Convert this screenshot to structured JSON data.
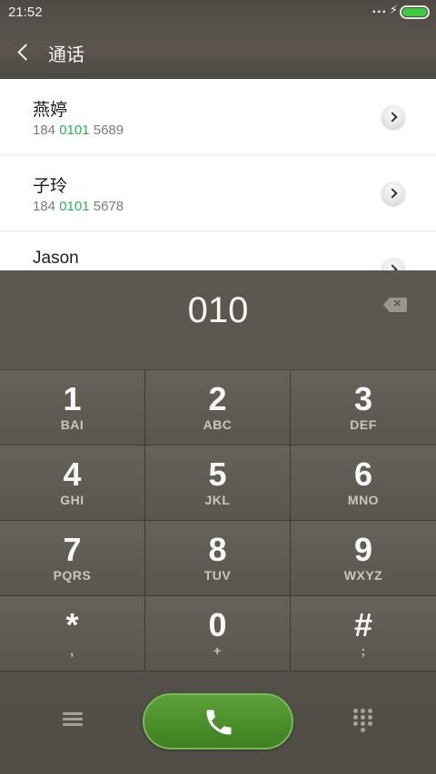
{
  "status_bar": {
    "time": "21:52",
    "dots": "...",
    "charging_icon": "bolt-icon",
    "battery_icon": "battery-icon",
    "battery_color": "#3fc93f"
  },
  "header": {
    "title": "通话",
    "back_icon": "chevron-left-icon"
  },
  "contacts": [
    {
      "name": "燕婷",
      "number_prefix": "184 ",
      "number_match": "0101",
      "number_suffix": " 5689"
    },
    {
      "name": "子玲",
      "number_prefix": "184 ",
      "number_match": "0101",
      "number_suffix": " 5678"
    },
    {
      "name": "Jason",
      "number_prefix": "",
      "number_match": "",
      "number_suffix": ""
    }
  ],
  "dialer": {
    "input_value": "010",
    "highlight_color": "#27b456",
    "keys": [
      {
        "digit": "1",
        "letters": "BAI"
      },
      {
        "digit": "2",
        "letters": "ABC"
      },
      {
        "digit": "3",
        "letters": "DEF"
      },
      {
        "digit": "4",
        "letters": "GHI"
      },
      {
        "digit": "5",
        "letters": "JKL"
      },
      {
        "digit": "6",
        "letters": "MNO"
      },
      {
        "digit": "7",
        "letters": "PQRS"
      },
      {
        "digit": "8",
        "letters": "TUV"
      },
      {
        "digit": "9",
        "letters": "WXYZ"
      },
      {
        "digit": "*",
        "letters": ","
      },
      {
        "digit": "0",
        "letters": "+"
      },
      {
        "digit": "#",
        "letters": ";"
      }
    ],
    "call_button_color": "#4a8f2a"
  }
}
